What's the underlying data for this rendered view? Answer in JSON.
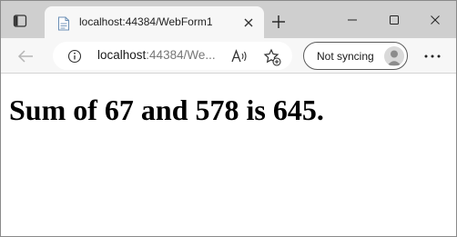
{
  "tab": {
    "title": "localhost:44384/WebForm1"
  },
  "address": {
    "host": "localhost",
    "rest": ":44384/We..."
  },
  "sync": {
    "label": "Not syncing"
  },
  "page": {
    "result_text": "Sum of 67 and 578 is 645."
  },
  "icons": {
    "tab_actions": "tab-actions-icon",
    "favicon": "page-icon",
    "close": "close-icon",
    "new_tab": "plus-icon",
    "minimize": "minimize-icon",
    "maximize": "maximize-icon",
    "window_close": "close-icon",
    "back": "arrow-left-icon",
    "info": "info-icon",
    "read_aloud": "read-aloud-icon",
    "favorites": "star-add-icon",
    "avatar": "person-icon",
    "more": "ellipsis-icon"
  },
  "colors": {
    "tabstrip": "#cfcfcf",
    "toolbar": "#f7f7f7"
  }
}
